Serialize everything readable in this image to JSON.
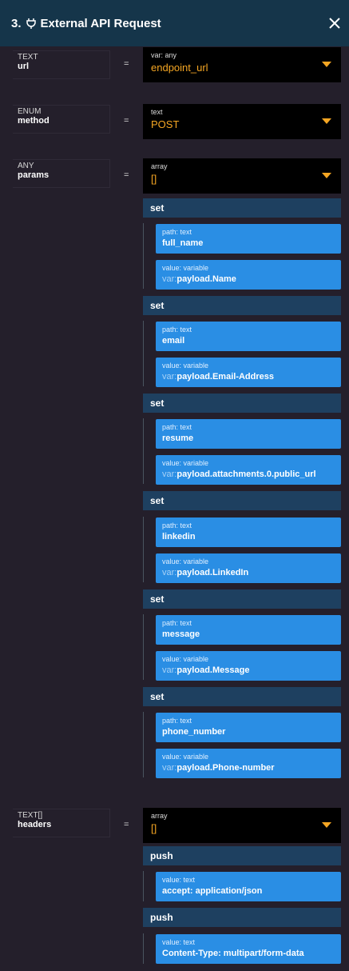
{
  "header": {
    "number": "3.",
    "title": "External API Request"
  },
  "args": [
    {
      "type": "TEXT",
      "name": "url",
      "eq": "=",
      "select_type": "var: any",
      "select_value": "endpoint_url"
    },
    {
      "type": "ENUM",
      "name": "method",
      "eq": "=",
      "select_type": "text",
      "select_value": "POST"
    },
    {
      "type": "ANY",
      "name": "params",
      "eq": "=",
      "select_type": "array",
      "select_value": "[]"
    },
    {
      "type": "TEXT[]",
      "name": "headers",
      "eq": "=",
      "select_type": "array",
      "select_value": "[]"
    }
  ],
  "params_items": [
    {
      "op": "set",
      "path_type": "path: text",
      "path": "full_name",
      "value_type": "value: variable",
      "value_prefix": "var:",
      "value": "payload.Name"
    },
    {
      "op": "set",
      "path_type": "path: text",
      "path": "email",
      "value_type": "value: variable",
      "value_prefix": "var:",
      "value": "payload.Email-Address"
    },
    {
      "op": "set",
      "path_type": "path: text",
      "path": "resume",
      "value_type": "value: variable",
      "value_prefix": "var:",
      "value": "payload.attachments.0.public_url"
    },
    {
      "op": "set",
      "path_type": "path: text",
      "path": "linkedin",
      "value_type": "value: variable",
      "value_prefix": "var:",
      "value": "payload.LinkedIn"
    },
    {
      "op": "set",
      "path_type": "path: text",
      "path": "message",
      "value_type": "value: variable",
      "value_prefix": "var:",
      "value": "payload.Message"
    },
    {
      "op": "set",
      "path_type": "path: text",
      "path": "phone_number",
      "value_type": "value: variable",
      "value_prefix": "var:",
      "value": "payload.Phone-number"
    }
  ],
  "headers_items": [
    {
      "op": "push",
      "value_type": "value: text",
      "value": "accept: application/json"
    },
    {
      "op": "push",
      "value_type": "value: text",
      "value": "Content-Type: multipart/form-data"
    }
  ],
  "icons": {
    "header": "plug-icon",
    "close": "close-icon",
    "caret": "caret-down-icon"
  },
  "colors": {
    "header_bg": "#15354a",
    "accent": "#f5a623",
    "tile": "#2a8ee4",
    "op_bar": "#1e4060",
    "background": "#241f2b"
  }
}
